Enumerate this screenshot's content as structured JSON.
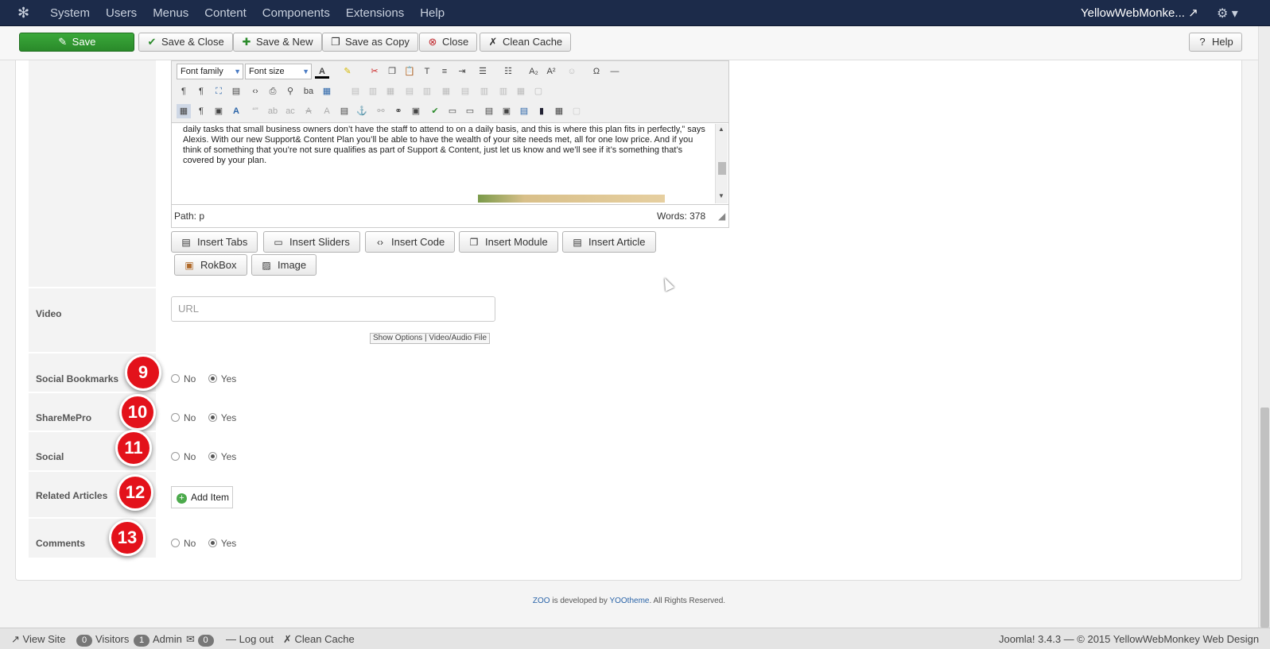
{
  "topbar": {
    "menu": [
      "System",
      "Users",
      "Menus",
      "Content",
      "Components",
      "Extensions",
      "Help"
    ],
    "site_name": "YellowWebMonke..."
  },
  "toolbar": {
    "save": "Save",
    "save_close": "Save & Close",
    "save_new": "Save & New",
    "save_copy": "Save as Copy",
    "close": "Close",
    "clean_cache": "Clean Cache",
    "help": "Help"
  },
  "editor": {
    "font_family": "Font family",
    "font_size": "Font size",
    "body_text": "daily tasks that small business owners don’t have the staff to attend to on a daily basis, and this is where this plan fits in perfectly,” says Alexis. With our new Support& Content Plan you’ll be able to have the wealth of your site needs met, all for one low price. And if you think of something that you’re not sure qualifies as part of Support & Content, just let us know and we’ll see if it’s something that’s covered by your plan.",
    "path": "Path:  p",
    "words": "Words: 378"
  },
  "insert_buttons": [
    "Insert Tabs",
    "Insert Sliders",
    "Insert Code",
    "Insert Module",
    "Insert Article",
    "RokBox",
    "Image"
  ],
  "fields": {
    "video": {
      "label": "Video",
      "placeholder": "URL",
      "options": "Show Options  |  Video/Audio File"
    },
    "social_bookmarks": {
      "label": "Social Bookmarks",
      "no": "No",
      "yes": "Yes",
      "badge": "9"
    },
    "sharemepro": {
      "label": "ShareMePro",
      "no": "No",
      "yes": "Yes",
      "badge": "10"
    },
    "social": {
      "label": "Social",
      "no": "No",
      "yes": "Yes",
      "badge": "11"
    },
    "related": {
      "label": "Related Articles",
      "add": "Add Item",
      "badge": "12"
    },
    "comments": {
      "label": "Comments",
      "no": "No",
      "yes": "Yes",
      "badge": "13"
    }
  },
  "footer": {
    "zoo": "ZOO",
    "mid": " is developed by ",
    "yoo": "YOOtheme",
    "end": ". All Rights Reserved."
  },
  "status": {
    "view_site": "View Site",
    "visitors_count": "0",
    "visitors": "Visitors",
    "admin_count": "1",
    "admin": "Admin",
    "mail_count": "0",
    "logout": "Log out",
    "clean_cache": "Clean Cache",
    "copyright": "Joomla! 3.4.3  —  © 2015 YellowWebMonkey Web Design"
  },
  "colors": {
    "navbar": "#1c2b4a",
    "save_green": "#2f9a2f",
    "badge_red": "#e3121b"
  }
}
